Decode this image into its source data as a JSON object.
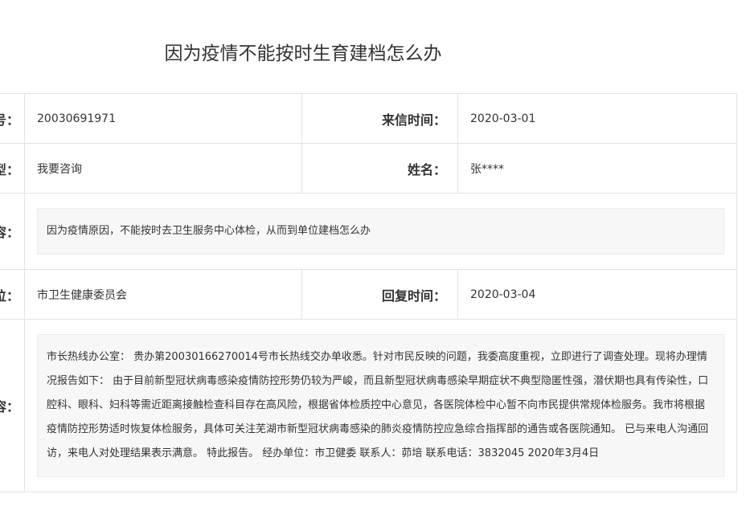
{
  "title": "因为疫情不能按时生育建档怎么办",
  "rows": {
    "r1": {
      "label_left": "号：",
      "value_left": "20030691971",
      "label_right": "来信时间：",
      "value_right": "2020-03-01"
    },
    "r2": {
      "label_left": "型：",
      "value_left": "我要咨询",
      "label_right": "姓名：",
      "value_right": "张****"
    },
    "r3": {
      "label_left": "容：",
      "content": "因为疫情原因，不能按时去卫生服务中心体检，从而到单位建档怎么办"
    },
    "r4": {
      "label_left": "位：",
      "value_left": "市卫生健康委员会",
      "label_right": "回复时间：",
      "value_right": "2020-03-04"
    },
    "r5": {
      "label_left": "容：",
      "content": "市长热线办公室： 贵办第20030166270014号市长热线交办单收悉。针对市民反映的问题，我委高度重视，立即进行了调查处理。现将办理情况报告如下： 由于目前新型冠状病毒感染疫情防控形势仍较为严峻，而且新型冠状病毒感染早期症状不典型隐匿性强，潜伏期也具有传染性，口腔科、眼科、妇科等需近距离接触检查科目存在高风险，根据省体检质控中心意见，各医院体检中心暂不向市民提供常规体检服务。我市将根据疫情防控形势适时恢复体检服务，具体可关注芜湖市新型冠状病毒感染的肺炎疫情防控应急综合指挥部的通告或各医院通知。 已与来电人沟通回访，来电人对处理结果表示满意。 特此报告。 经办单位：市卫健委 联系人：茆培 联系电话：3832045 2020年3月4日"
    }
  }
}
